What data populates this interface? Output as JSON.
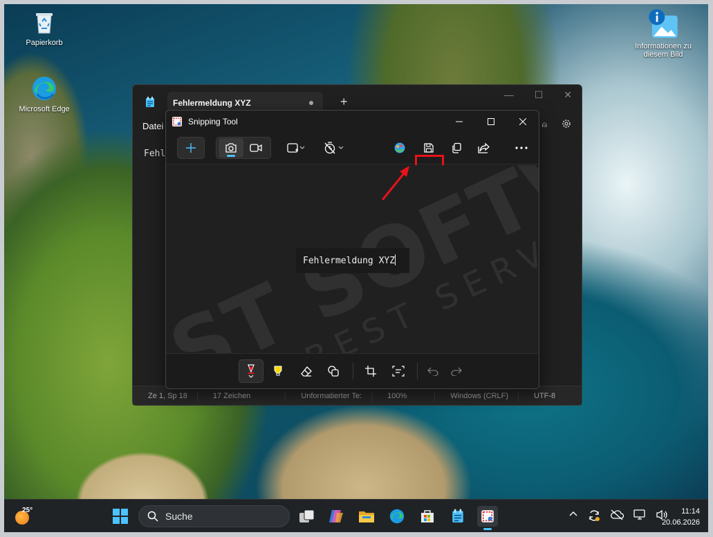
{
  "desktop": {
    "icons": [
      {
        "label": "Papierkorb",
        "icon": "recycle-bin-icon"
      },
      {
        "label": "Microsoft Edge",
        "icon": "edge-icon"
      },
      {
        "label": "Informationen zu diesem Bild",
        "icon": "image-info-icon"
      }
    ]
  },
  "notepad": {
    "tab_title": "Fehlermeldung XYZ",
    "menu_first": "Datei",
    "text_preview": "Fehl",
    "status": {
      "position": "Ze 1, Sp 18",
      "chars": "17 Zeichen",
      "format": "Unformatierter Te:",
      "zoom": "100%",
      "line_ending": "Windows (CRLF)",
      "encoding": "UTF-8"
    }
  },
  "snipping_tool": {
    "title": "Snipping Tool",
    "snip_text": "Fehlermeldung XYZ"
  },
  "taskbar": {
    "weather_temp": "25°",
    "search_placeholder": "Suche",
    "time": "11:14",
    "date": "20.06.2026"
  },
  "colors": {
    "accent": "#4cc2ff",
    "highlight_red": "#e8121a"
  }
}
